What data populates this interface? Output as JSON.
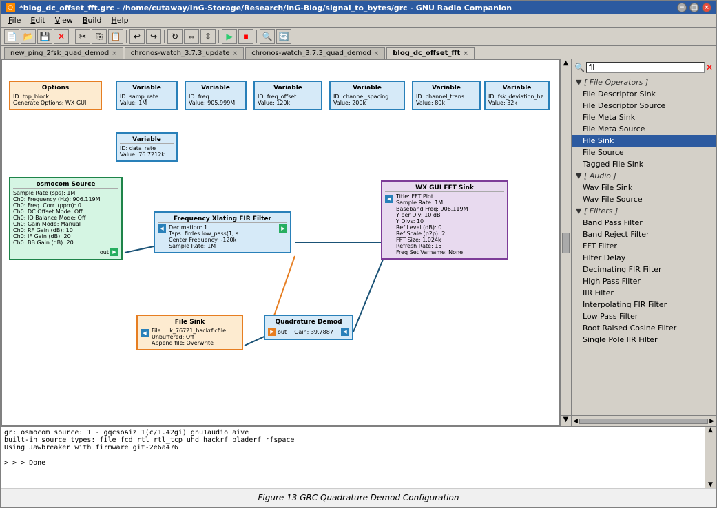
{
  "window": {
    "title": "*blog_dc_offset_fft.grc - /home/cutaway/InG-Storage/Research/InG-Blog/signal_to_bytes/grc - GNU Radio Companion",
    "icon": "○"
  },
  "menubar": {
    "items": [
      "File",
      "Edit",
      "View",
      "Build",
      "Help"
    ]
  },
  "tabs": [
    {
      "label": "new_ping_2fsk_quad_demod",
      "active": false
    },
    {
      "label": "chronos-watch_3.7.3_update",
      "active": false
    },
    {
      "label": "chronos-watch_3.7.3_quad_demod",
      "active": false
    },
    {
      "label": "blog_dc_offset_fft",
      "active": true
    }
  ],
  "sidebar": {
    "search_placeholder": "fil",
    "categories": [
      {
        "name": "[ File Operators ]",
        "items": [
          {
            "label": "File Descriptor Sink",
            "selected": false
          },
          {
            "label": "File Descriptor Source",
            "selected": false
          },
          {
            "label": "File Meta Sink",
            "selected": false
          },
          {
            "label": "File Meta Source",
            "selected": false
          },
          {
            "label": "File Sink",
            "selected": true
          },
          {
            "label": "File Source",
            "selected": false
          },
          {
            "label": "Tagged File Sink",
            "selected": false
          }
        ]
      },
      {
        "name": "[ Audio ]",
        "items": [
          {
            "label": "Wav File Sink",
            "selected": false
          },
          {
            "label": "Wav File Source",
            "selected": false
          }
        ]
      },
      {
        "name": "[ Filters ]",
        "items": [
          {
            "label": "Band Pass Filter",
            "selected": false
          },
          {
            "label": "Band Reject Filter",
            "selected": false
          },
          {
            "label": "FFT Filter",
            "selected": false
          },
          {
            "label": "Filter Delay",
            "selected": false
          },
          {
            "label": "Decimating FIR Filter",
            "selected": false
          },
          {
            "label": "High Pass Filter",
            "selected": false
          },
          {
            "label": "IIR Filter",
            "selected": false
          },
          {
            "label": "Interpolating FIR Filter",
            "selected": false
          },
          {
            "label": "Low Pass Filter",
            "selected": false
          },
          {
            "label": "Root Raised Cosine Filter",
            "selected": false
          },
          {
            "label": "Single Pole IIR Filter",
            "selected": false
          }
        ]
      }
    ]
  },
  "blocks": {
    "options": {
      "title": "Options",
      "id": "top_block",
      "generate": "WX GUI"
    },
    "var1": {
      "title": "Variable",
      "id": "samp_rate",
      "value": "1M"
    },
    "var2": {
      "title": "Variable",
      "id": "freq",
      "value": "905.999M"
    },
    "var3": {
      "title": "Variable",
      "id": "freq_offset",
      "value": "120k"
    },
    "var4": {
      "title": "Variable",
      "id": "channel_spacing",
      "value": "200k"
    },
    "var5": {
      "title": "Variable",
      "id": "channel_trans",
      "value": "80k"
    },
    "var6": {
      "title": "Variable",
      "id": "fsk_deviation_hz",
      "value": "32k"
    },
    "var7": {
      "title": "Variable",
      "id": "data_rate",
      "value": "76.7212k"
    },
    "osmocom": {
      "title": "osmocom Source",
      "rows": [
        "Sample Rate (sps): 1M",
        "Ch0: Frequency (Hz): 906.119M",
        "Ch0: Freq. Corr. (ppm): 0",
        "Ch0: DC Offset Mode: Off",
        "Ch0: IQ Balance Mode: Off",
        "Ch0: Gain Mode: Manual",
        "Ch0: RF Gain (dB): 10",
        "Ch0: IF Gain (dB): 20",
        "Ch0: BB Gain (dB): 20"
      ]
    },
    "fir": {
      "title": "Frequency Xlating FIR Filter",
      "rows": [
        "Decimation: 1",
        "Taps: firdes.low_pass(1, s...",
        "Center Frequency: -120k",
        "Sample Rate: 1M"
      ]
    },
    "filesink": {
      "title": "File Sink",
      "rows": [
        "File: ...k_76721_hackrf.cfile",
        "Unbuffered: Off",
        "Append file: Overwrite"
      ]
    },
    "quaddemod": {
      "title": "Quadrature Demod",
      "rows": [
        "Gain: 39.7887"
      ]
    },
    "wxgui": {
      "title": "WX GUI FFT Sink",
      "rows": [
        "Title: FFT Plot",
        "Sample Rate: 1M",
        "Baseband Freq: 906.119M",
        "Y per Div: 10 dB",
        "Y Divs: 10",
        "Ref Level (dB): 0",
        "Ref Scale (p2p): 2",
        "FFT Size: 1.024k",
        "Refresh Rate: 15",
        "Freq Set Varname: None"
      ]
    }
  },
  "console": {
    "lines": [
      "gr: osmocom_source: 1 - gqcsoAiz 1(c/1.42gi) gnu1audio aive",
      "built-in source types: file fcd rtl rtl_tcp uhd hackrf bladerf rfspace",
      "Using Jawbreaker with firmware git-2e6a476",
      "",
      "> > > Done"
    ]
  },
  "caption": "Figure 13 GRC Quadrature Demod Configuration",
  "toolbar_icons": [
    "new",
    "open",
    "save",
    "close",
    "sep",
    "cut",
    "copy",
    "paste",
    "sep",
    "undo",
    "redo",
    "sep",
    "execute",
    "stop",
    "sep",
    "find"
  ]
}
